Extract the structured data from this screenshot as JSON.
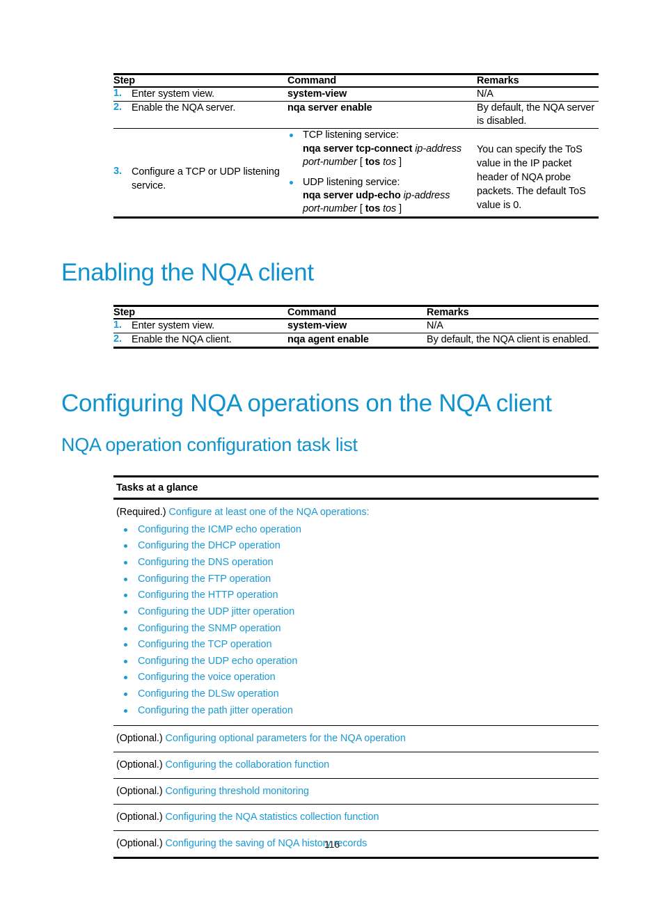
{
  "page": {
    "number": "116",
    "accent_heading_color": "#0f93cf",
    "accent_link_color": "#1b9ad6",
    "text_color": "#000000"
  },
  "server_table": {
    "headers": {
      "step": "Step",
      "command": "Command",
      "remarks": "Remarks"
    },
    "rows": [
      {
        "num": "1.",
        "step": "Enter system view.",
        "command": "system-view",
        "remarks": "N/A"
      },
      {
        "num": "2.",
        "step": "Enable the NQA server.",
        "command": "nqa server enable",
        "remarks": "By default, the NQA server is disabled."
      },
      {
        "num": "3.",
        "step": "Configure a TCP or UDP listening service.",
        "remarks": "You can specify the ToS value in the IP packet header of NQA probe packets. The default ToS value is 0.",
        "command_bullets": [
          {
            "intro": "TCP listening service:",
            "cmd_bold_1": "nqa server tcp-connect",
            "arg_italic_1": "ip-address",
            "arg_italic_2": "port-number",
            "bracket_open": "[",
            "opt_bold": "tos",
            "opt_italic": "tos",
            "bracket_close": "]"
          },
          {
            "intro": "UDP listening service:",
            "cmd_bold_1": "nqa server udp-echo",
            "arg_italic_1": "ip-address",
            "arg_italic_2": "port-number",
            "bracket_open": "[",
            "opt_bold": "tos",
            "opt_italic": "tos",
            "bracket_close": "]"
          }
        ]
      }
    ]
  },
  "heading_enabling_client": "Enabling the NQA client",
  "client_table": {
    "headers": {
      "step": "Step",
      "command": "Command",
      "remarks": "Remarks"
    },
    "rows": [
      {
        "num": "1.",
        "step": "Enter system view.",
        "command": "system-view",
        "remarks": "N/A"
      },
      {
        "num": "2.",
        "step": "Enable the NQA client.",
        "command": "nqa agent enable",
        "remarks": "By default, the NQA client is enabled."
      }
    ]
  },
  "heading_configuring_ops": "Configuring NQA operations on the NQA client",
  "heading_task_list": "NQA operation configuration task list",
  "tasks_table": {
    "header": "Tasks at a glance",
    "required_row": {
      "prefix": "(Required.)",
      "link": "Configure at least one of the NQA operations:",
      "items": [
        "Configuring the ICMP echo operation",
        "Configuring the DHCP operation",
        "Configuring the DNS operation",
        "Configuring the FTP operation",
        "Configuring the HTTP operation",
        "Configuring the UDP jitter operation",
        "Configuring the SNMP operation",
        "Configuring the TCP operation",
        "Configuring the UDP echo operation",
        "Configuring the voice operation",
        "Configuring the DLSw operation",
        "Configuring the path jitter operation"
      ]
    },
    "optional_rows": [
      {
        "prefix": "(Optional.)",
        "link": "Configuring optional parameters for the NQA operation"
      },
      {
        "prefix": "(Optional.)",
        "link": "Configuring the collaboration function"
      },
      {
        "prefix": "(Optional.)",
        "link": "Configuring threshold monitoring"
      },
      {
        "prefix": "(Optional.)",
        "link": "Configuring the NQA statistics collection function"
      },
      {
        "prefix": "(Optional.)",
        "link": "Configuring the saving of NQA history records"
      }
    ]
  }
}
